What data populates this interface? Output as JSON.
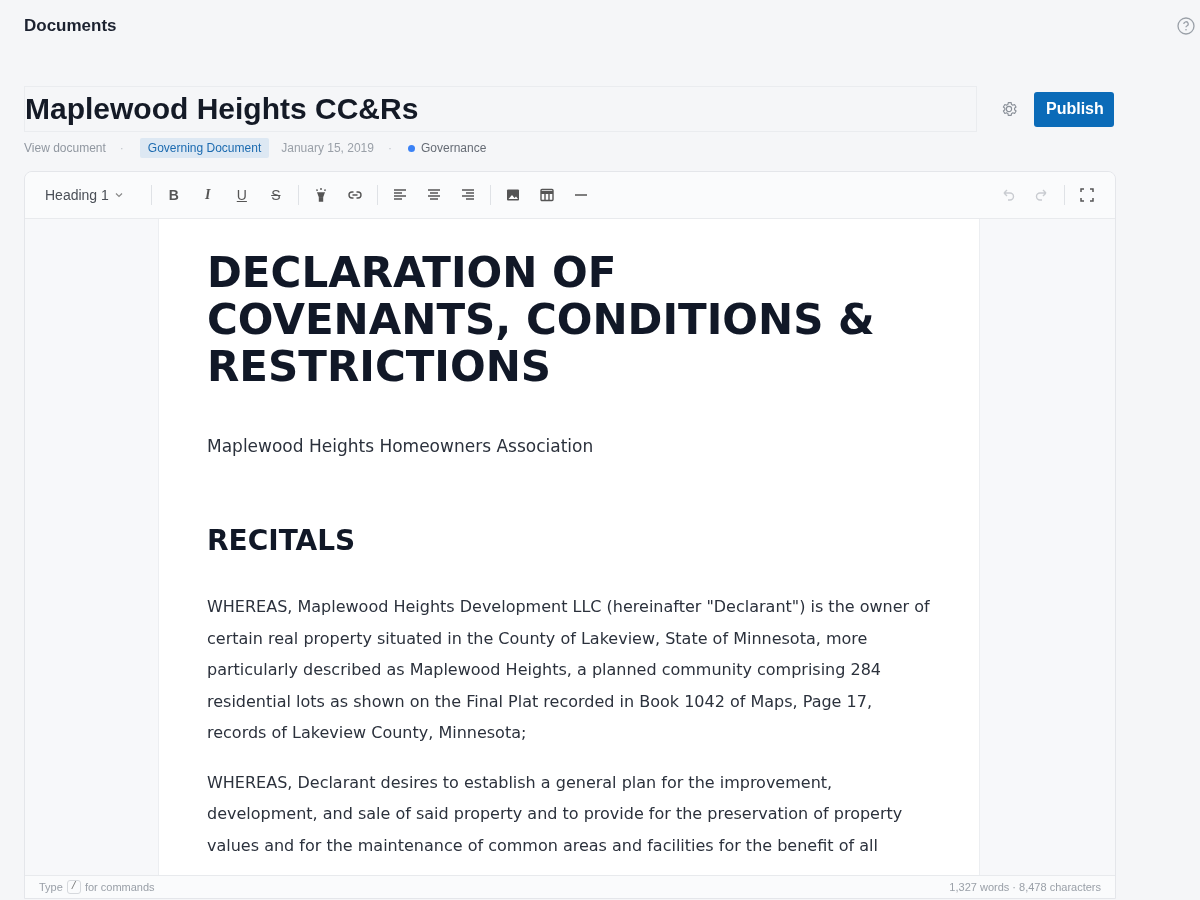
{
  "header": {
    "title": "Documents"
  },
  "document": {
    "title": "Maplewood Heights CC&Rs",
    "publish_label": "Publish"
  },
  "meta": {
    "view_link": "View document",
    "separator_1": "·",
    "type_tag": "Governing Document",
    "date": "January 15, 2019",
    "separator_2": "·",
    "category": "Governance"
  },
  "toolbar": {
    "block_style": "Heading 1",
    "groups": [
      [
        {
          "kind": "bold",
          "label": "B"
        },
        {
          "kind": "italic",
          "label": "I"
        },
        {
          "kind": "underline",
          "label": "U"
        },
        {
          "kind": "strike",
          "label": "S"
        }
      ],
      [
        {
          "kind": "highlight"
        },
        {
          "kind": "link"
        }
      ],
      [
        {
          "kind": "align-left"
        },
        {
          "kind": "align-center"
        },
        {
          "kind": "align-right"
        }
      ],
      [
        {
          "kind": "image"
        },
        {
          "kind": "table"
        },
        {
          "kind": "rule"
        }
      ]
    ],
    "history": [
      {
        "kind": "undo",
        "disabled": true
      },
      {
        "kind": "redo",
        "disabled": true
      }
    ]
  },
  "content": [
    {
      "kind": "title",
      "text": "DECLARATION OF COVENANTS, CONDITIONS & RESTRICTIONS"
    },
    {
      "kind": "subtitle",
      "text": "Maplewood Heights Homeowners Association"
    },
    {
      "kind": "heading",
      "text": "RECITALS"
    },
    {
      "kind": "paragraph",
      "text": "WHEREAS, Maplewood Heights Development LLC (hereinafter \"Declarant\") is the owner of certain real property situated in the County of Lakeview, State of Minnesota, more particularly described as Maplewood Heights, a planned community comprising 284 residential lots as shown on the Final Plat recorded in Book 1042 of Maps, Page 17, records of Lakeview County, Minnesota;"
    },
    {
      "kind": "paragraph",
      "text": "WHEREAS, Declarant desires to establish a general plan for the improvement, development, and sale of said property and to provide for the preservation of property values and for the maintenance of common areas and facilities for the benefit of all"
    }
  ],
  "footer": {
    "hint_before": "Type",
    "hint_key": "/",
    "hint_after": "for commands",
    "stats": "1,327 words · 8,478 characters"
  }
}
